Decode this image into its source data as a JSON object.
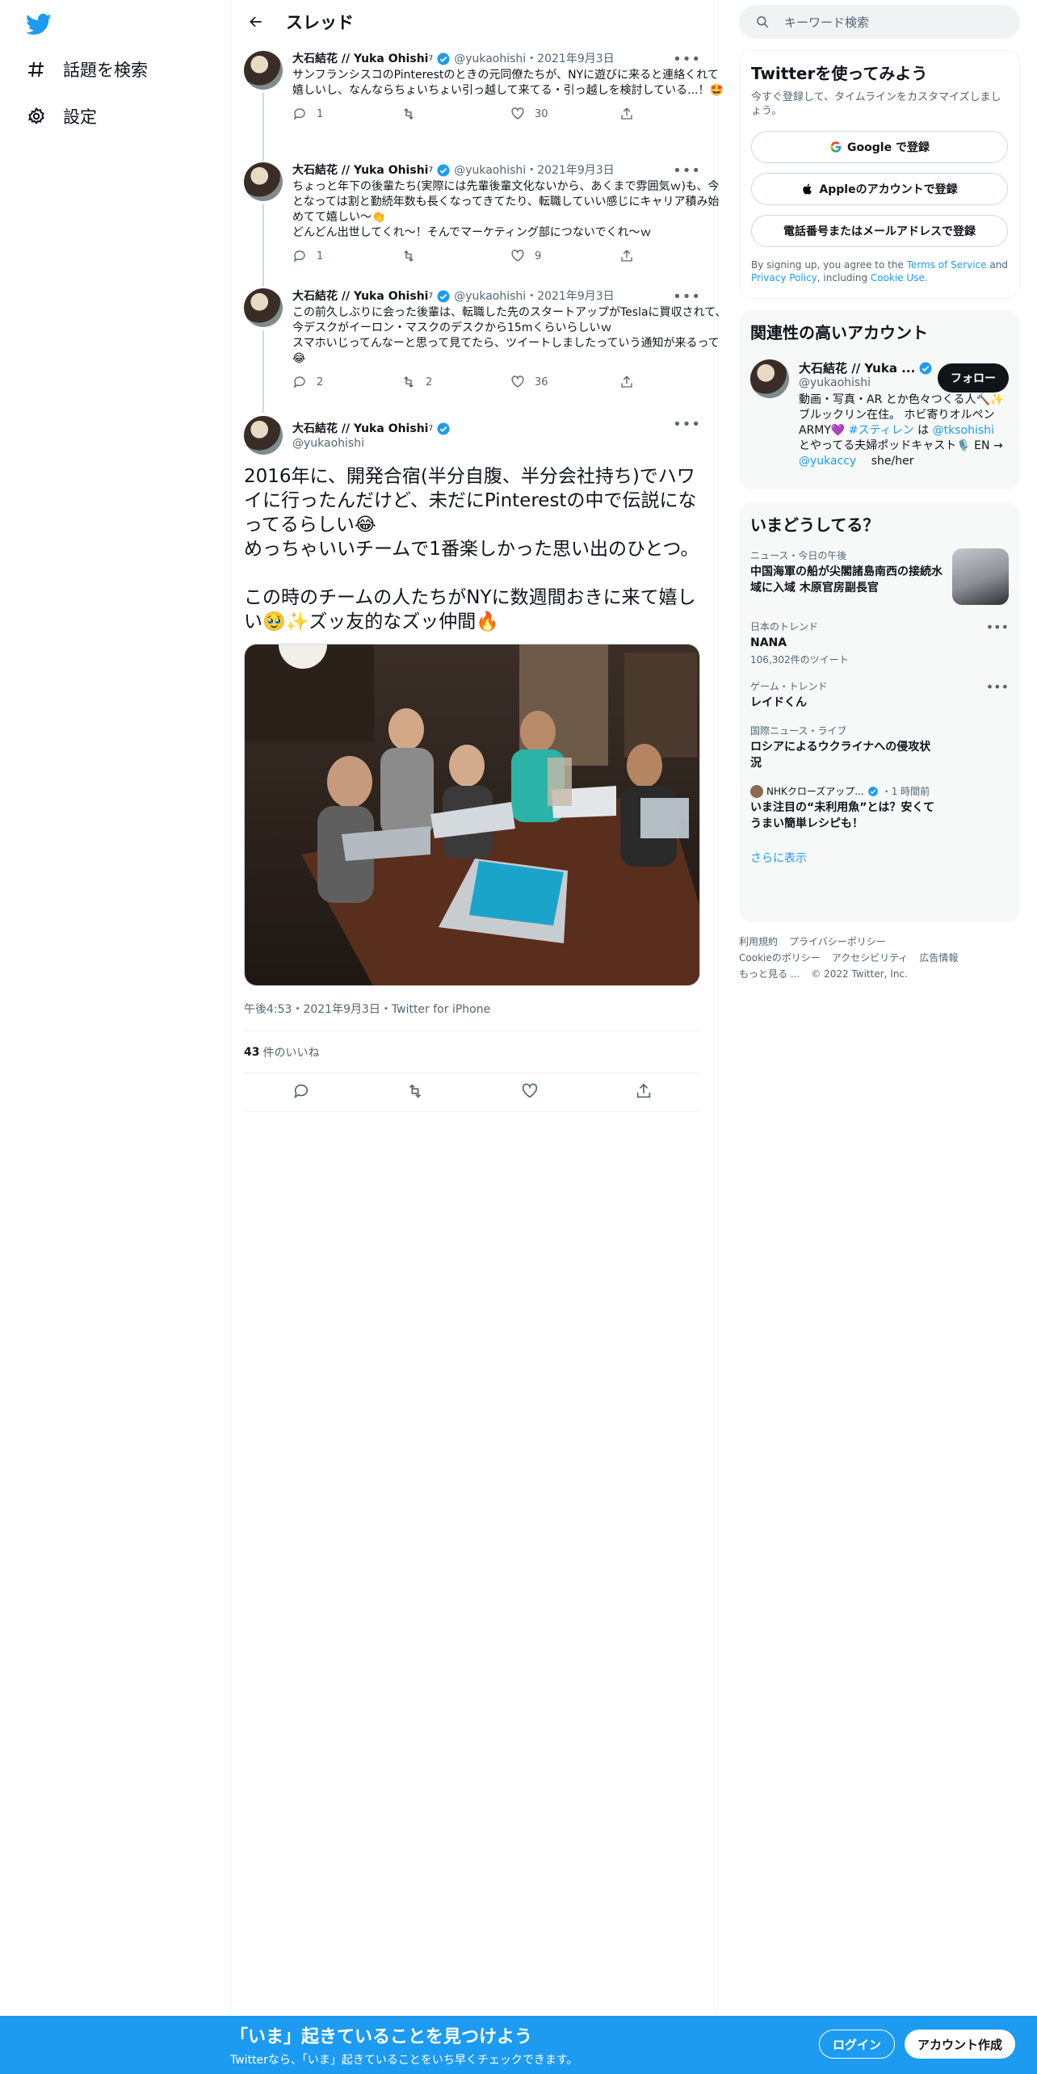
{
  "nav": {
    "explore_label": "話題を検索",
    "settings_label": "設定"
  },
  "header": {
    "title": "スレッド"
  },
  "thread": [
    {
      "name": "大石結花 // Yuka Ohishi",
      "superscript": "7",
      "handle": "@yukaohishi",
      "date": "2021年9月3日",
      "text": "サンフランシスコのPinterestのときの元同僚たちが、NYに遊びに来ると連絡くれて嬉しいし、なんならちょいちょい引っ越して来てる・引っ越しを検討している...！🤩",
      "replies": "1",
      "retweets": "",
      "likes": "30"
    },
    {
      "name": "大石結花 // Yuka Ohishi",
      "superscript": "7",
      "handle": "@yukaohishi",
      "date": "2021年9月3日",
      "text": "ちょっと年下の後輩たち(実際には先輩後輩文化ないから、あくまで雰囲気ｗ)も、今となっては割と勤続年数も長くなってきてたり、転職していい感じにキャリア積み始めてて嬉しい〜👏\nどんどん出世してくれ〜！そんでマーケティング部につないでくれ〜ｗ",
      "replies": "1",
      "retweets": "",
      "likes": "9"
    },
    {
      "name": "大石結花 // Yuka Ohishi",
      "superscript": "7",
      "handle": "@yukaohishi",
      "date": "2021年9月3日",
      "text": "この前久しぶりに会った後輩は、転職した先のスタートアップがTeslaに買収されて、今デスクがイーロン・マスクのデスクから15mくらいらしいｗ\nスマホいじってんなーと思って見てたら、ツイートしましたっていう通知が来るって😂",
      "replies": "2",
      "retweets": "2",
      "likes": "36"
    }
  ],
  "focus": {
    "name": "大石結花 // Yuka Ohishi",
    "superscript": "7",
    "handle": "@yukaohishi",
    "text": "2016年に、開発合宿(半分自腹、半分会社持ち)でハワイに行ったんだけど、未だにPinterestの中で伝説になってるらしい😂\nめっちゃいいチームで1番楽しかった思い出のひとつ。\n\nこの時のチームの人たちがNYに数週間おきに来て嬉しい🥹✨ズッ友的なズッ仲間🔥",
    "meta": "午後4:53・2021年9月3日・Twitter for iPhone",
    "like_count": "43",
    "like_label": "件のいいね"
  },
  "search": {
    "placeholder": "キーワード検索"
  },
  "signup": {
    "title": "Twitterを使ってみよう",
    "subtitle": "今すぐ登録して、タイムラインをカスタマイズしましょう。",
    "google": "Google で登録",
    "apple": "Appleのアカウントで登録",
    "phone": "電話番号またはメールアドレスで登録",
    "terms_pre": "By signing up, you agree to the ",
    "terms_link": "Terms of Service",
    "terms_and": " and ",
    "privacy_link": "Privacy Policy",
    "including": ", including ",
    "cookie_link": "Cookie Use."
  },
  "related": {
    "title": "関連性の高いアカウント",
    "name": "大石結花 // Yuka ...",
    "handle": "@yukaohishi",
    "follow": "フォロー",
    "bio_1": "動画・写真・AR とか色々つくる人🔨✨ ブルックリン在住。 ホビ寄りオルペンARMY💜 ",
    "bio_tag": "#スティレン",
    "bio_2": " は ",
    "bio_mention1": "@tksohishi",
    "bio_3": " とやってる夫婦ポッドキャスト🎙️ EN → ",
    "bio_mention2": "@yukaccy",
    "bio_4": "　 she/her"
  },
  "trends": {
    "title": "いまどうしてる？",
    "items": [
      {
        "category": "ニュース・今日の午後",
        "title": "中国海軍の船が尖閣諸島南西の接続水域に入域 木原官房副長官",
        "count": ""
      },
      {
        "category": "日本のトレンド",
        "title": "NANA",
        "count": "106,302件のツイート"
      },
      {
        "category": "ゲーム・トレンド",
        "title": "レイドくん",
        "count": ""
      },
      {
        "category": "国際ニュース・ライブ",
        "title": "ロシアによるウクライナへの侵攻状況",
        "count": ""
      },
      {
        "category": "NHKクローズアップ...",
        "category_time": "・1 時間前",
        "title": "いま注目の“未利用魚”とは？安くてうまい簡単レシピも！",
        "count": ""
      }
    ],
    "show_more": "さらに表示"
  },
  "footer": {
    "terms": "利用規約",
    "privacy": "プライバシーポリシー",
    "cookie": "Cookieのポリシー",
    "accessibility": "アクセシビリティ",
    "ads": "広告情報",
    "more": "もっと見る ...",
    "copyright": "© 2022 Twitter, Inc."
  },
  "bottom_bar": {
    "title": "「いま」起きていることを見つけよう",
    "subtitle": "Twitterなら、「いま」起きていることをいち早くチェックできます。",
    "login": "ログイン",
    "signup": "アカウント作成"
  },
  "colors": {
    "accent": "#1d9bf0",
    "text": "#0f1419",
    "muted": "#536471",
    "border": "#eff3f4"
  }
}
